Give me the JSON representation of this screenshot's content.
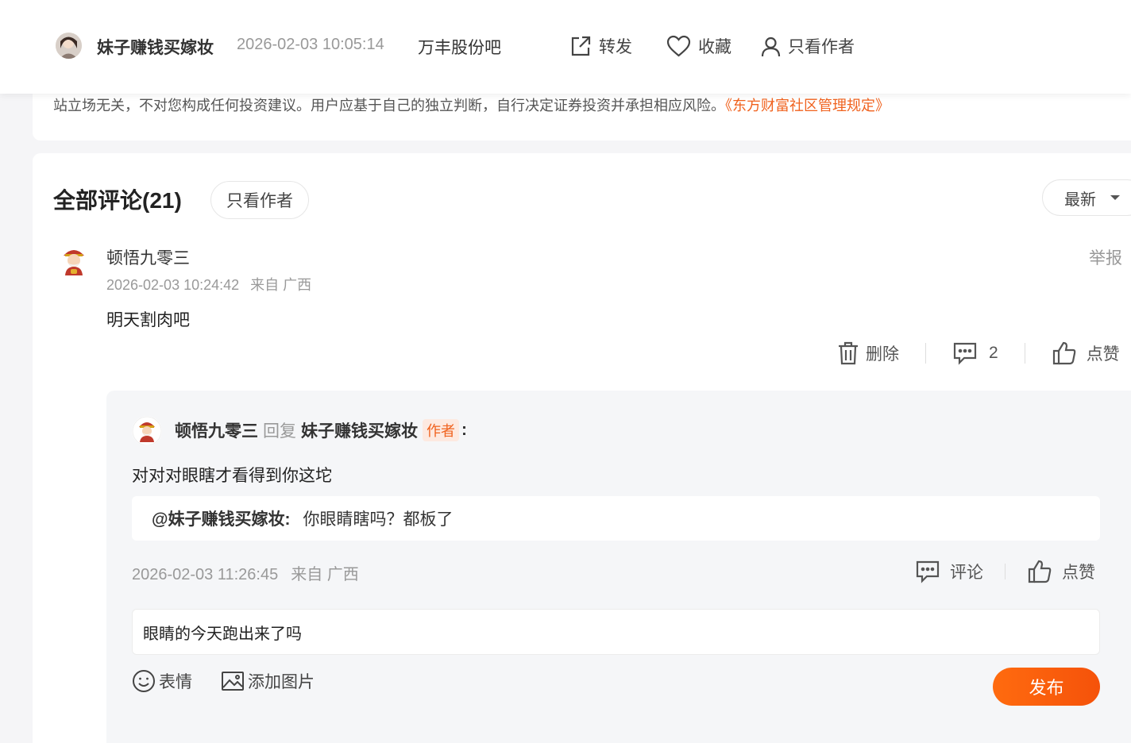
{
  "header": {
    "author_name": "妹子赚钱买嫁妆",
    "post_time": "2026-02-03 10:05:14",
    "bar_name": "万丰股份吧",
    "forward_label": "转发",
    "favorite_label": "收藏",
    "only_author_label": "只看作者"
  },
  "disclaimer": {
    "text": "站立场无关，不对您构成任何投资建议。用户应基于自己的独立判断，自行决定证券投资并承担相应风险。",
    "rule_link": "《东方财富社区管理规定》"
  },
  "comments": {
    "title": "全部评论(21)",
    "filter_author_label": "只看作者",
    "sort_label": "最新",
    "items": [
      {
        "user": "顿悟九零三",
        "time": "2026-02-03 10:24:42",
        "location": "来自 广西",
        "report_label": "举报",
        "body": "明天割肉吧",
        "delete_label": "删除",
        "reply_count": "2",
        "like_label": "点赞",
        "reply": {
          "user": "顿悟九零三",
          "verb": "回复",
          "target": "妹子赚钱买嫁妆",
          "target_tag": "作者",
          "colon": ":",
          "text": "对对对眼瞎才看得到你这坨",
          "quote_user": "@妹子赚钱买嫁妆:",
          "quote_text": "你眼睛瞎吗？都板了",
          "time": "2026-02-03 11:26:45",
          "location": "来自 广西",
          "comment_label": "评论",
          "like_label": "点赞"
        }
      }
    ]
  },
  "composer": {
    "input_value": "眼睛的今天跑出来了吗",
    "emoji_label": "表情",
    "image_label": "添加图片",
    "publish_label": "发布"
  },
  "colors": {
    "accent": "#f0621e",
    "publish_button": "#ff6b0f",
    "muted_text": "#999999"
  }
}
